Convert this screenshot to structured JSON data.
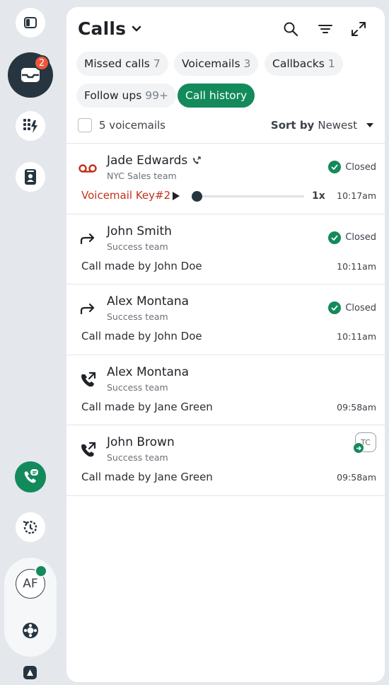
{
  "rail": {
    "inbox_badge": "2",
    "avatar_initials": "AF",
    "icons": [
      "sidebar-toggle-icon",
      "inbox-icon",
      "keypad-bolt-icon",
      "contact-book-icon",
      "phone-chat-icon",
      "history-icon",
      "help-lifebuoy-icon",
      "brand-logo"
    ]
  },
  "header": {
    "title": "Calls"
  },
  "chips": [
    {
      "label": "Missed calls",
      "count": "7",
      "active": false
    },
    {
      "label": "Voicemails",
      "count": "3",
      "active": false
    },
    {
      "label": "Callbacks",
      "count": "1",
      "active": false
    },
    {
      "label": "Follow ups",
      "count": "99+",
      "active": false
    },
    {
      "label": "Call history",
      "count": "",
      "active": true
    }
  ],
  "toolbar": {
    "count_label": "5 voicemails",
    "sort_prefix": "Sort by",
    "sort_value": "Newest"
  },
  "calls": [
    {
      "name": "Jade Edwards",
      "team": "NYC Sales team",
      "type": "voicemail",
      "detail": "Voicemail Key#2",
      "status": "Closed",
      "time": "10:17am",
      "speed": "1x",
      "playback_progress": 0.04
    },
    {
      "name": "John Smith",
      "team": "Success team",
      "type": "forwarded",
      "detail": "Call made by John Doe",
      "status": "Closed",
      "time": "10:11am"
    },
    {
      "name": "Alex Montana",
      "team": "Success team",
      "type": "forwarded",
      "detail": "Call made by John Doe",
      "status": "Closed",
      "time": "10:11am"
    },
    {
      "name": "Alex Montana",
      "team": "Success team",
      "type": "outgoing",
      "detail": "Call made by Jane Green",
      "status": "",
      "time": "09:58am"
    },
    {
      "name": "John Brown",
      "team": "Success team",
      "type": "outgoing",
      "detail": "Call made by Jane Green",
      "status": "",
      "time": "09:58am",
      "assignee": "TC"
    }
  ],
  "colors": {
    "accent": "#138a5b",
    "voicemail": "#c0321c",
    "badge": "#f0553a",
    "dark": "#263540"
  }
}
